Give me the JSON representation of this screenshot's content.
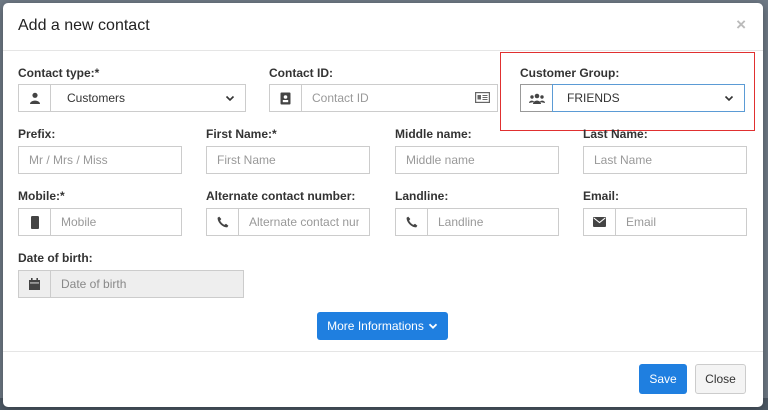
{
  "modal": {
    "title": "Add a new contact",
    "close_glyph": "×"
  },
  "contact_type": {
    "label": "Contact type:*",
    "value": "Customers",
    "icon": "user-icon"
  },
  "contact_id": {
    "label": "Contact ID:",
    "placeholder": "Contact ID",
    "icon": "id-badge-icon",
    "trailing_icon": "id-card-icon"
  },
  "customer_group": {
    "label": "Customer Group:",
    "value": "FRIENDS",
    "icon": "users-icon",
    "highlight_color": "#e03030"
  },
  "prefix": {
    "label": "Prefix:",
    "placeholder": "Mr / Mrs / Miss"
  },
  "first_name": {
    "label": "First Name:*",
    "placeholder": "First Name"
  },
  "middle_name": {
    "label": "Middle name:",
    "placeholder": "Middle name"
  },
  "last_name": {
    "label": "Last Name:",
    "placeholder": "Last Name"
  },
  "mobile": {
    "label": "Mobile:*",
    "placeholder": "Mobile",
    "icon": "mobile-icon"
  },
  "alternate": {
    "label": "Alternate contact number:",
    "placeholder": "Alternate contact number",
    "icon": "phone-icon"
  },
  "landline": {
    "label": "Landline:",
    "placeholder": "Landline",
    "icon": "phone-icon"
  },
  "email": {
    "label": "Email:",
    "placeholder": "Email",
    "icon": "envelope-icon"
  },
  "dob": {
    "label": "Date of birth:",
    "placeholder": "Date of birth",
    "icon": "calendar-icon"
  },
  "actions": {
    "more_info": "More Informations",
    "save": "Save",
    "close": "Close"
  },
  "colors": {
    "primary": "#1f7fe0",
    "focus_border": "#5b9bd5"
  }
}
